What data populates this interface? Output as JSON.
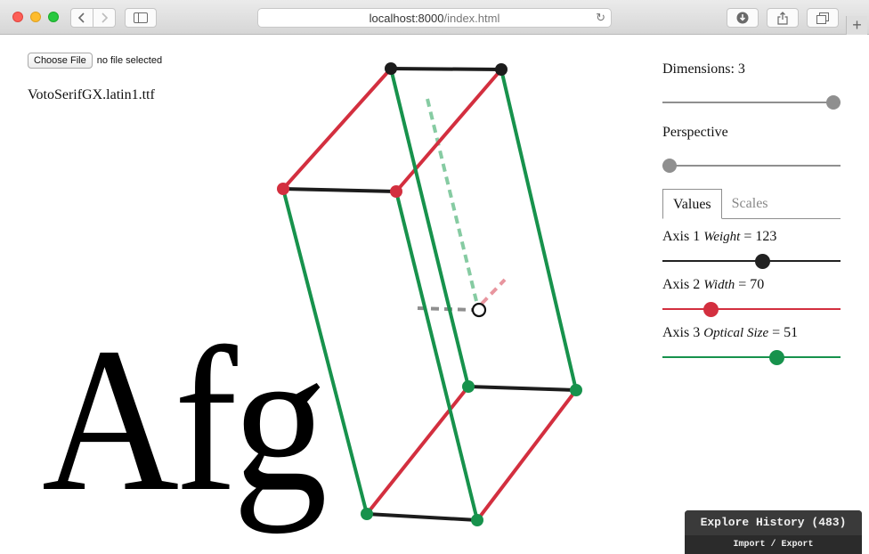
{
  "browser": {
    "url_host": "localhost:8000",
    "url_path": "/index.html"
  },
  "file": {
    "button_label": "Choose File",
    "status": "no file selected",
    "font_name": "VotoSerifGX.latin1.ttf"
  },
  "specimen_text": "Afg",
  "panel": {
    "dimensions_label": "Dimensions: 3",
    "dimensions_value": 3,
    "dimensions_max": 3,
    "perspective_label": "Perspective",
    "perspective_value": 0,
    "tabs": [
      {
        "label": "Values",
        "active": true
      },
      {
        "label": "Scales",
        "active": false
      }
    ],
    "axes": [
      {
        "prefix": "Axis 1",
        "name": "Weight",
        "suffix": "= 123",
        "fraction": 0.56,
        "color": "#222222"
      },
      {
        "prefix": "Axis 2",
        "name": "Width",
        "suffix": "= 70",
        "fraction": 0.27,
        "color": "#d32f3f"
      },
      {
        "prefix": "Axis 3",
        "name": "Optical Size",
        "suffix": "= 51",
        "fraction": 0.64,
        "color": "#17924c"
      }
    ]
  },
  "history": {
    "title": "Explore History (483)",
    "links": "Import / Export"
  },
  "colors": {
    "axis_black": "#1c1c1c",
    "axis_red": "#d32f3f",
    "axis_green": "#17924c"
  }
}
